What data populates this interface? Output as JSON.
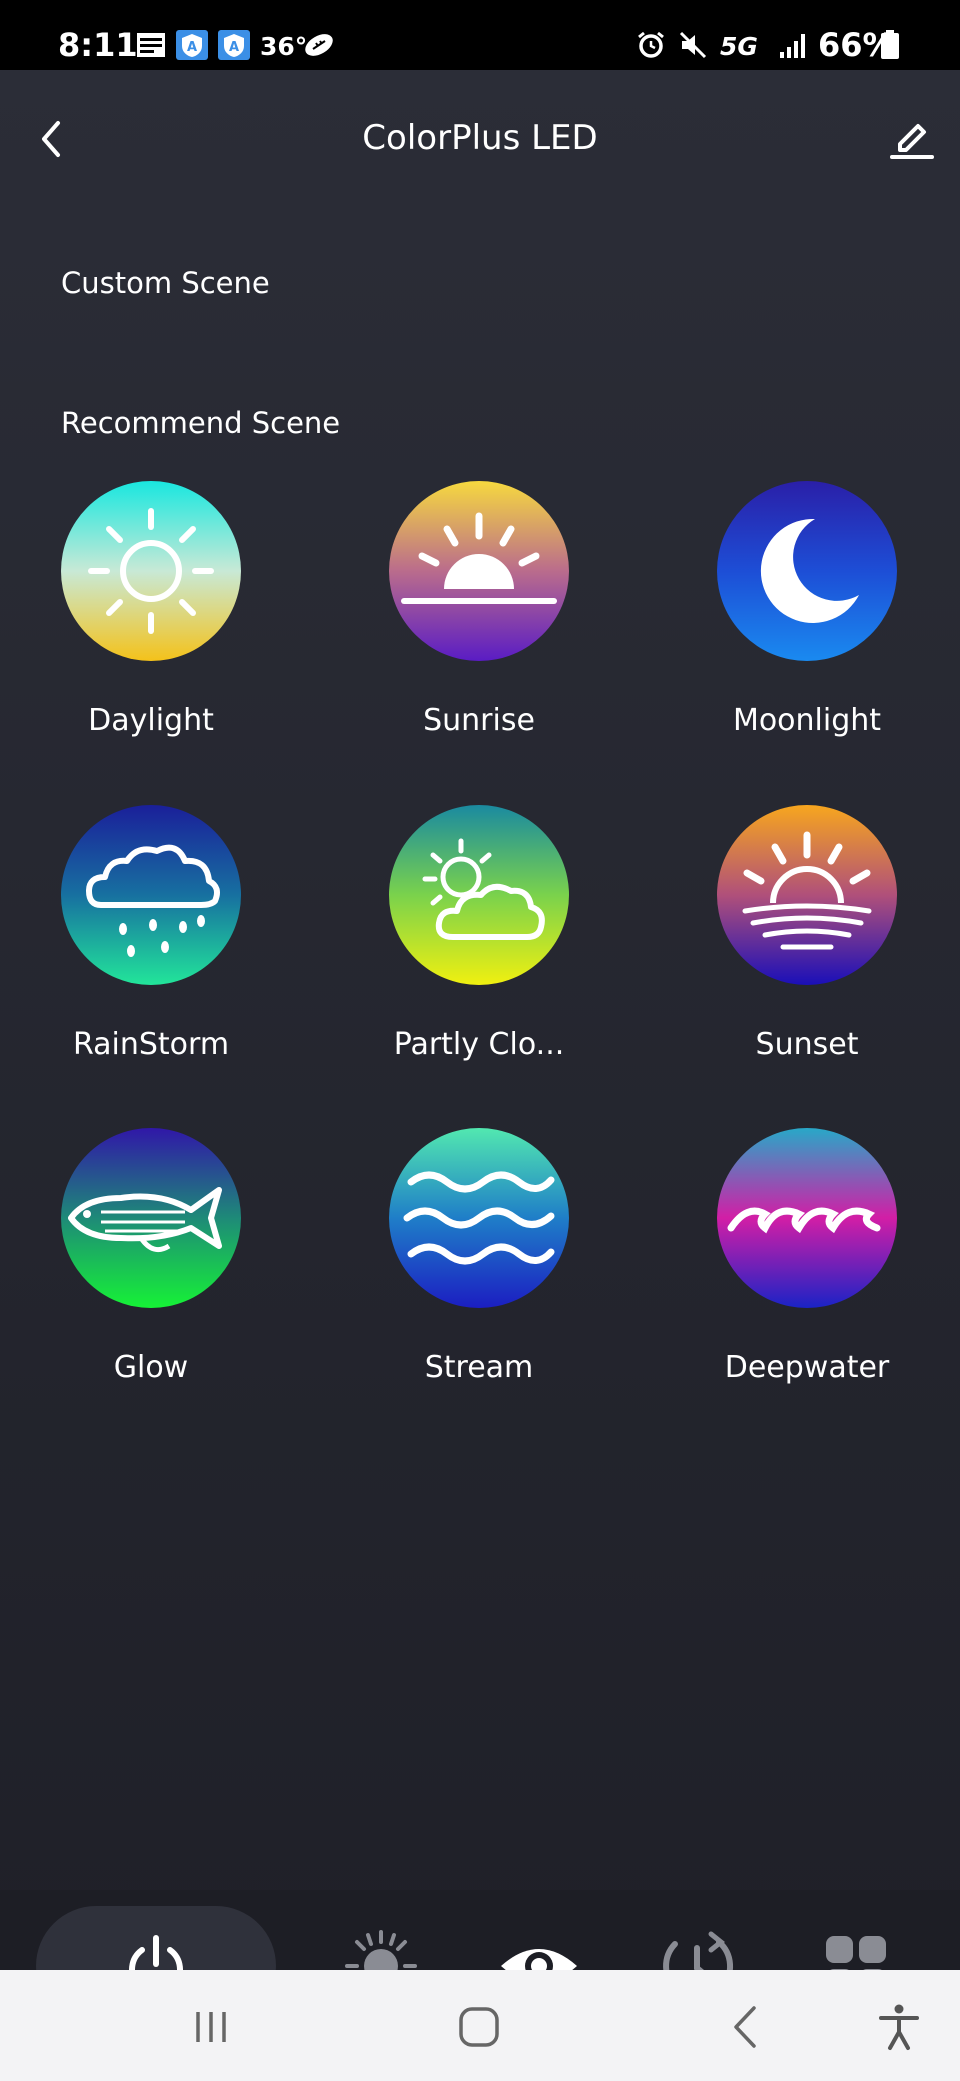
{
  "status_bar": {
    "time": "8:11",
    "temperature": "36°",
    "network": "5G",
    "battery": "66%",
    "icons": [
      "news-icon",
      "shield-a-icon",
      "shield-a-icon",
      "football-icon",
      "alarm-icon",
      "mute-icon",
      "signal-icon",
      "battery-icon"
    ]
  },
  "header": {
    "title": "ColorPlus LED",
    "back_icon": "chevron-left-icon",
    "edit_icon": "pencil-icon"
  },
  "sections": {
    "custom": "Custom Scene",
    "recommend": "Recommend Scene"
  },
  "scenes": [
    {
      "label": "Daylight",
      "icon": "sun-icon",
      "colors": [
        "#19e7df",
        "#c8e9d6",
        "#f4c21a"
      ]
    },
    {
      "label": "Sunrise",
      "icon": "sunrise-icon",
      "colors": [
        "#f6d93f",
        "#ba6c8c",
        "#5a1cc4"
      ]
    },
    {
      "label": "Moonlight",
      "icon": "moon-icon",
      "colors": [
        "#2a1fa8",
        "#1d4ed6",
        "#1a8af0"
      ]
    },
    {
      "label": "RainStorm",
      "icon": "rain-cloud-icon",
      "colors": [
        "#1a1f9a",
        "#1770a0",
        "#22e59a"
      ]
    },
    {
      "label": "Partly Clo...",
      "icon": "partly-cloudy-icon",
      "colors": [
        "#1a8aa0",
        "#7ad24c",
        "#f0f010"
      ]
    },
    {
      "label": "Sunset",
      "icon": "sunset-icon",
      "colors": [
        "#f7a61e",
        "#b0507a",
        "#1a0fb8"
      ]
    },
    {
      "label": "Glow",
      "icon": "fish-icon",
      "colors": [
        "#3017a8",
        "#1e8a78",
        "#16f236"
      ]
    },
    {
      "label": "Stream",
      "icon": "waves-icon",
      "colors": [
        "#52e8b0",
        "#1f7ec8",
        "#1b1ec2"
      ]
    },
    {
      "label": "Deepwater",
      "icon": "deep-waves-icon",
      "colors": [
        "#28a8c8",
        "#d21ea6",
        "#1a23c6"
      ]
    }
  ],
  "tabs": [
    {
      "name": "power",
      "icon": "power-icon",
      "active": false
    },
    {
      "name": "brightness",
      "icon": "sun-dim-icon",
      "active": false
    },
    {
      "name": "scene",
      "icon": "eye-icon",
      "active": true
    },
    {
      "name": "schedule",
      "icon": "clock-icon",
      "active": false
    },
    {
      "name": "more",
      "icon": "grid-icon",
      "active": false
    }
  ],
  "system_nav": [
    "recents-icon",
    "home-icon",
    "back-icon",
    "accessibility-icon"
  ]
}
